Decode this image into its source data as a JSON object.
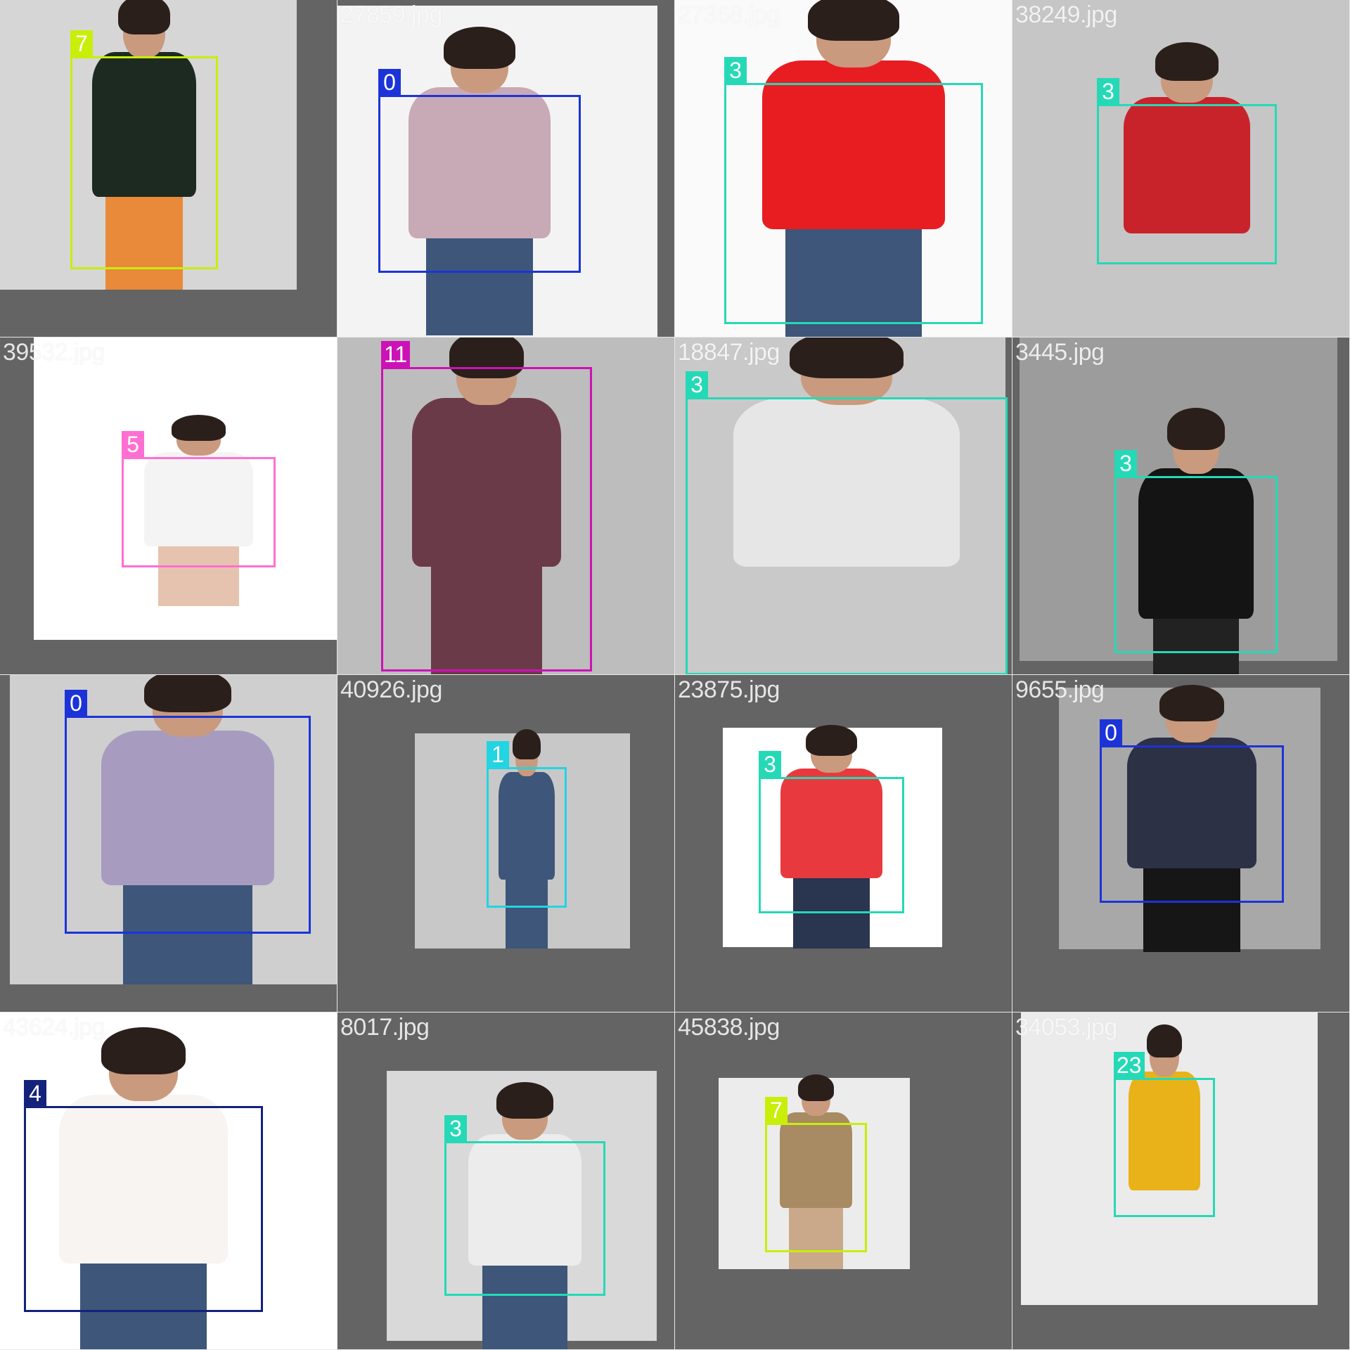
{
  "tiles": [
    {
      "filename": "",
      "label": "7",
      "color": "#c8ee0a",
      "photo_bg": "#d6d6d6",
      "garment": "#1d2a22",
      "pants": "#e88a3a"
    },
    {
      "filename": "27859.jpg",
      "label": "0",
      "color": "#1c33d8",
      "photo_bg": "#f3f3f3",
      "garment": "#c8a9b6",
      "pants": "#3d5679"
    },
    {
      "filename": "27368.jpg",
      "label": "3",
      "color": "#25d9b6",
      "photo_bg": "#fafafa",
      "garment": "#e81d22",
      "pants": "#3d5679"
    },
    {
      "filename": "38249.jpg",
      "label": "3",
      "color": "#25d9b6",
      "photo_bg": "#c6c6c6",
      "garment": "#c8232b",
      "pants": "#c6c6c6"
    },
    {
      "filename": "39532.jpg",
      "label": "5",
      "color": "#ff6fd2",
      "photo_bg": "#ffffff",
      "garment": "#f4f4f4",
      "pants": "#e6c3ae"
    },
    {
      "filename": "",
      "label": "11",
      "color": "#cc12b6",
      "photo_bg": "#bdbdbd",
      "garment": "#6b3a48",
      "pants": "#6b3a48"
    },
    {
      "filename": "18847.jpg",
      "label": "3",
      "color": "#25d9b6",
      "photo_bg": "#c9c9c9",
      "garment": "#e6e6e6",
      "pants": "#c9c9c9"
    },
    {
      "filename": "3445.jpg",
      "label": "3",
      "color": "#25d9b6",
      "photo_bg": "#9c9c9c",
      "garment": "#141414",
      "pants": "#222222"
    },
    {
      "filename": "",
      "label": "0",
      "color": "#1c33d8",
      "photo_bg": "#cfcfcf",
      "garment": "#a79cc0",
      "pants": "#3d5679"
    },
    {
      "filename": "40926.jpg",
      "label": "1",
      "color": "#23d4e2",
      "photo_bg": "#c8c8c8",
      "garment": "#3d5679",
      "pants": "#3d5679"
    },
    {
      "filename": "23875.jpg",
      "label": "3",
      "color": "#25d9b6",
      "photo_bg": "#ffffff",
      "garment": "#e83a3e",
      "pants": "#2a3550"
    },
    {
      "filename": "9655.jpg",
      "label": "0",
      "color": "#1c33d8",
      "photo_bg": "#a8a8a8",
      "garment": "#2c3146",
      "pants": "#161616"
    },
    {
      "filename": "43624.jpg",
      "label": "4",
      "color": "#13227a",
      "photo_bg": "#ffffff",
      "garment": "#f7f4f2",
      "pants": "#3d5679"
    },
    {
      "filename": "8017.jpg",
      "label": "3",
      "color": "#25d9b6",
      "photo_bg": "#d9d9d9",
      "garment": "#ececec",
      "pants": "#3d5679"
    },
    {
      "filename": "45838.jpg",
      "label": "7",
      "color": "#c8ee0a",
      "photo_bg": "#ececec",
      "garment": "#a88b62",
      "pants": "#c9a98a"
    },
    {
      "filename": "34053.jpg",
      "label": "23",
      "color": "#25d9b6",
      "photo_bg": "#ebebeb",
      "garment": "#e8b218",
      "pants": "#ebebeb"
    }
  ]
}
